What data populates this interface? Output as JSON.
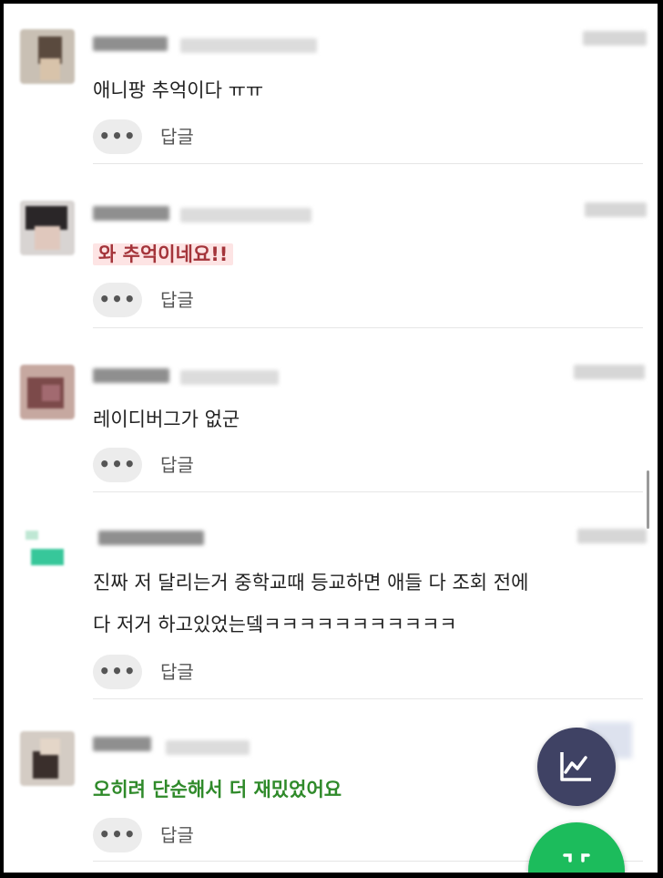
{
  "comments": [
    {
      "text": "애니팡 추억이다 ㅠㅠ",
      "more": "•••",
      "reply": "답글"
    },
    {
      "text": "와 추억이네요!!",
      "more": "•••",
      "reply": "답글"
    },
    {
      "text": "레이디버그가 없군",
      "more": "•••",
      "reply": "답글"
    },
    {
      "text_line1": "진짜 저 달리는거 중학교때 등교하면 애들 다 조회 전에",
      "text_line2": "다 저거 하고있었는뎈ㅋㅋㅋㅋㅋㅋㅋㅋㅋㅋㅋ",
      "more": "•••",
      "reply": "답글"
    },
    {
      "text": "오히려 단순해서 더 재밌었어요",
      "more": "•••",
      "reply": "답글"
    }
  ],
  "icons": {
    "chart_fab": "trending-chart-icon",
    "green_fab": "collapse-icon"
  },
  "colors": {
    "highlight_bg": "#fde4e4",
    "highlight_text": "#a4343a",
    "green_text": "#2f8a2a",
    "fab_dark": "#3f4264",
    "fab_green": "#1cbc5c"
  }
}
